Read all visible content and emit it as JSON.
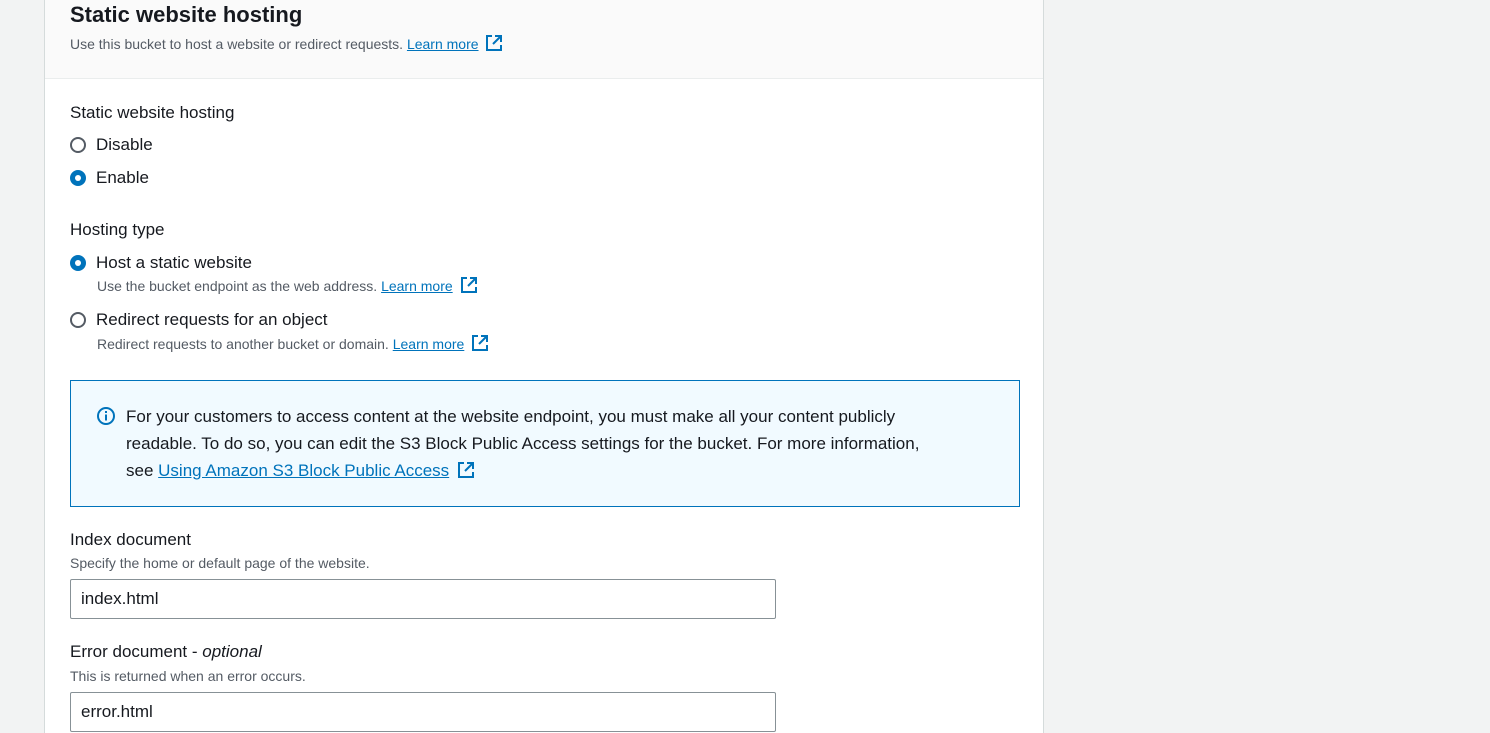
{
  "header": {
    "title": "Static website hosting",
    "description": "Use this bucket to host a website or redirect requests.",
    "learn_more": "Learn more"
  },
  "hosting_toggle": {
    "label": "Static website hosting",
    "options": [
      {
        "label": "Disable",
        "checked": false
      },
      {
        "label": "Enable",
        "checked": true
      }
    ]
  },
  "hosting_type": {
    "label": "Hosting type",
    "options": [
      {
        "label": "Host a static website",
        "description": "Use the bucket endpoint as the web address.",
        "learn_more": "Learn more",
        "checked": true
      },
      {
        "label": "Redirect requests for an object",
        "description": "Redirect requests to another bucket or domain.",
        "learn_more": "Learn more",
        "checked": false
      }
    ]
  },
  "info_alert": {
    "text_line1": "For your customers to access content at the website endpoint, you must make all your content publicly",
    "text_line2": "readable. To do so, you can edit the S3 Block Public Access settings for the bucket. For more information,",
    "text_prefix": "see",
    "link": "Using Amazon S3 Block Public Access"
  },
  "index_document": {
    "label": "Index document",
    "hint": "Specify the home or default page of the website.",
    "value": "index.html"
  },
  "error_document": {
    "label": "Error document - ",
    "label_optional": "optional",
    "hint": "This is returned when an error occurs.",
    "value": "error.html"
  },
  "colors": {
    "accent": "#0073bb",
    "info_bg": "#f1faff",
    "page_bg": "#f2f3f3"
  }
}
